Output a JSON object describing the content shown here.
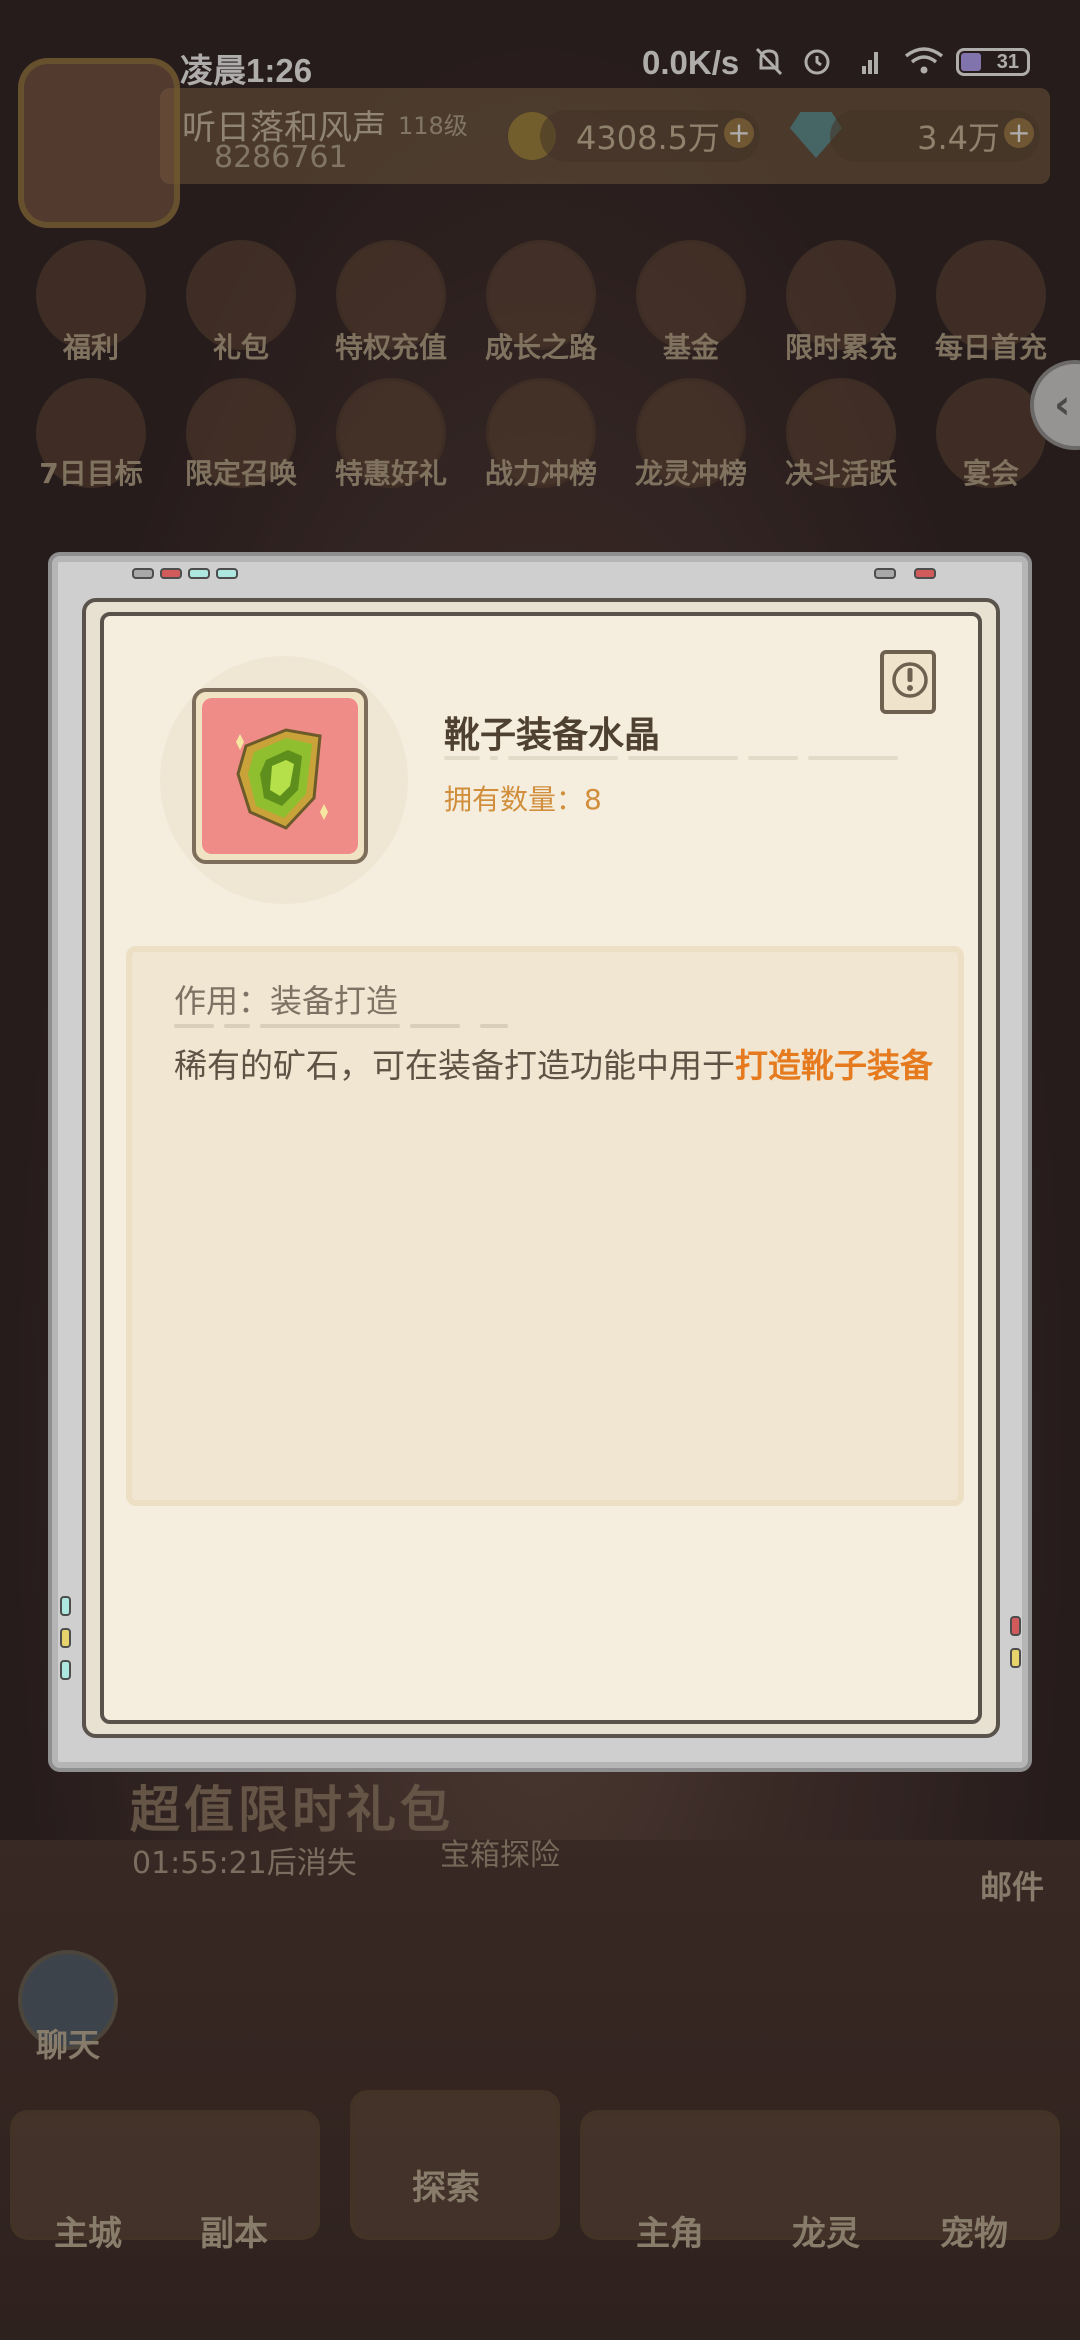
{
  "status_bar": {
    "time": "凌晨1:26",
    "network_speed": "0.0K/s",
    "battery": "31"
  },
  "player": {
    "name": "听日落和风声",
    "level": "118级",
    "power": "8286761",
    "gold": "4308.5万",
    "gems": "3.4万"
  },
  "features_row1": [
    "福利",
    "礼包",
    "特权充值",
    "成长之路",
    "基金",
    "限时累充",
    "每日首充"
  ],
  "features_row2": [
    "7日目标",
    "限定召唤",
    "特惠好礼",
    "战力冲榜",
    "龙灵冲榜",
    "决斗活跃",
    "宴会"
  ],
  "promo": {
    "title": "超值限时礼包",
    "timer": "01:55:21后消失",
    "treasure": "宝箱探险"
  },
  "mail_label": "邮件",
  "chat_label": "聊天",
  "nav": {
    "main_city": "主城",
    "dungeon": "副本",
    "explore": "探索",
    "hero": "主角",
    "dragon": "龙灵",
    "pet": "宠物"
  },
  "item": {
    "name": "靴子装备水晶",
    "count_text": "拥有数量：8",
    "usage_text": "作用：装备打造",
    "description_plain": "稀有的矿石，可在装备打造功能中用于",
    "description_highlight": "打造靴子装备",
    "slot_color": "#ef8c87",
    "highlight_color": "#e67a1f",
    "icon": "green-crystal-icon"
  }
}
